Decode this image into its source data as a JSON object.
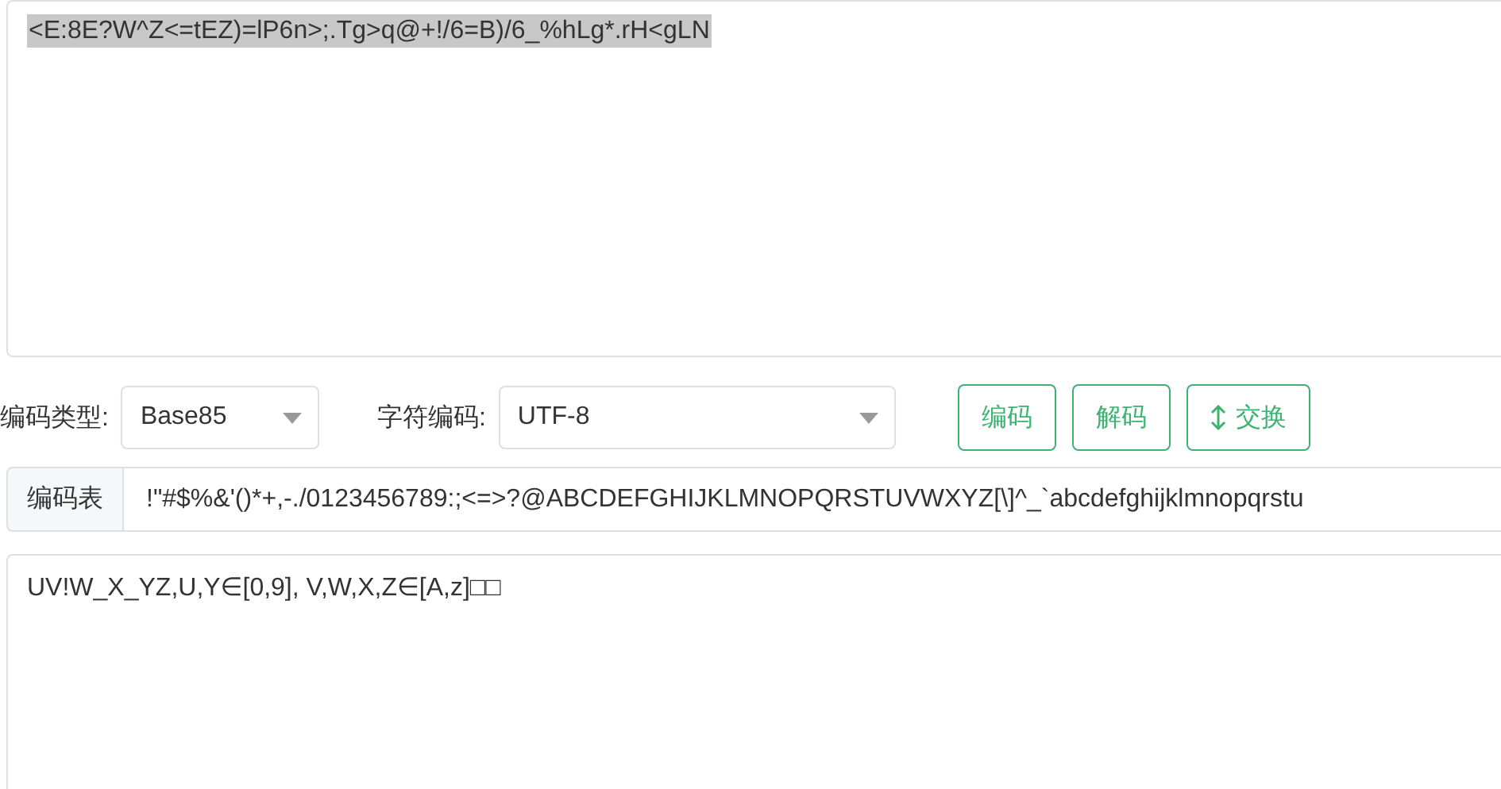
{
  "input": {
    "value": "<E:8E?W^Z<=tEZ)=lP6n>;.Tg>q@+!/6=B)/6_%hLg*.rH<gLN",
    "highlighted": true
  },
  "controls": {
    "encoding_type_label": "编码类型:",
    "encoding_type": "Base85",
    "charset_label": "字符编码:",
    "charset": "UTF-8",
    "buttons": [
      {
        "label": "编码",
        "kind": "plain"
      },
      {
        "label": "解码",
        "kind": "plain"
      },
      {
        "label": "交换",
        "kind": "swap"
      }
    ]
  },
  "alphabet": {
    "label": "编码表",
    "value": "!\"#$%&'()*+,-./0123456789:;<=>?@ABCDEFGHIJKLMNOPQRSTUVWXYZ[\\]^_`abcdefghijklmnopqrstu"
  },
  "output": {
    "value": "UV!W_X_YZ,U,Y∈[0,9], V,W,X,Z∈[A,z]□□"
  }
}
